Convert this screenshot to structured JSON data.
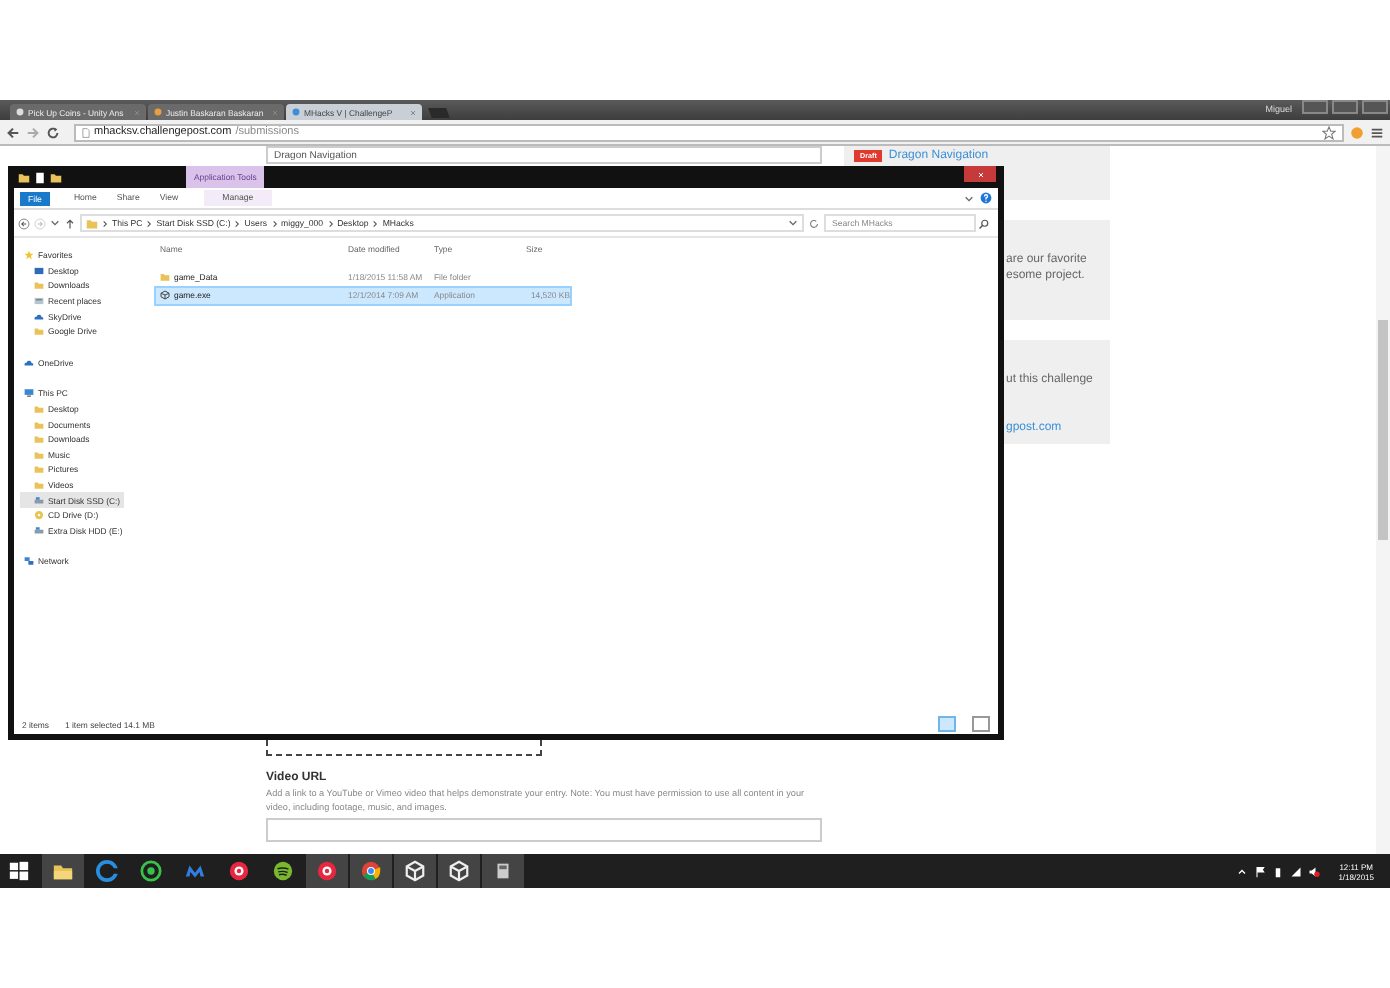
{
  "browser": {
    "tabs": [
      {
        "title": "Pick Up Coins - Unity Ans",
        "selected": false
      },
      {
        "title": "Justin Baskaran Baskaran",
        "selected": false
      },
      {
        "title": "MHacks V | ChallengeP",
        "selected": true
      }
    ],
    "user": "Miguel",
    "url_host": "mhacksv.challengepost.com",
    "url_path": "/submissions"
  },
  "page": {
    "title_field": {
      "value": "Dragon Navigation"
    },
    "cards": [
      {
        "badge": "Draft",
        "link": "Dragon Navigation"
      },
      {
        "lines": [
          "are our favorite",
          "esome project."
        ]
      },
      {
        "lines": [
          "ut this challenge"
        ],
        "link": "gpost.com"
      }
    ],
    "video_url": {
      "label": "Video URL",
      "help": "Add a link to a YouTube or Vimeo video that helps demonstrate your entry. Note: You must have permission to use all content in your video, including footage, music, and images."
    }
  },
  "explorer": {
    "contextual_tab": "Application Tools",
    "ribbon_tabs": [
      {
        "label": "File",
        "kind": "file"
      },
      {
        "label": "Home",
        "kind": "tab"
      },
      {
        "label": "Share",
        "kind": "tab"
      },
      {
        "label": "View",
        "kind": "tab"
      },
      {
        "label": "Manage",
        "kind": "tab"
      }
    ],
    "breadcrumbs": [
      "This PC",
      "Start Disk SSD (C:)",
      "Users",
      "miggy_000",
      "Desktop",
      "MHacks"
    ],
    "search": {
      "placeholder": "Search MHacks"
    },
    "nav": [
      {
        "label": "Favorites",
        "kind": "star",
        "selected": false,
        "children": [
          {
            "label": "Desktop",
            "kind": "desktop",
            "selected": false
          },
          {
            "label": "Downloads",
            "kind": "folder",
            "selected": false
          },
          {
            "label": "Recent places",
            "kind": "recent",
            "selected": false
          },
          {
            "label": "SkyDrive",
            "kind": "cloud",
            "selected": false
          },
          {
            "label": "Google Drive",
            "kind": "folder",
            "selected": false
          }
        ]
      },
      {
        "label": "OneDrive",
        "kind": "cloud",
        "selected": false
      },
      {
        "label": "This PC",
        "kind": "pc",
        "selected": false,
        "children": [
          {
            "label": "Desktop",
            "kind": "folder",
            "selected": false
          },
          {
            "label": "Documents",
            "kind": "folder",
            "selected": false
          },
          {
            "label": "Downloads",
            "kind": "folder",
            "selected": false
          },
          {
            "label": "Music",
            "kind": "folder",
            "selected": false
          },
          {
            "label": "Pictures",
            "kind": "folder",
            "selected": false
          },
          {
            "label": "Videos",
            "kind": "folder",
            "selected": false
          },
          {
            "label": "Start Disk SSD (C:)",
            "kind": "drive",
            "selected": true
          },
          {
            "label": "CD Drive (D:)",
            "kind": "disc",
            "selected": false
          },
          {
            "label": "Extra Disk HDD (E:)",
            "kind": "drive",
            "selected": false
          }
        ]
      },
      {
        "label": "Network",
        "kind": "network",
        "selected": false
      }
    ],
    "columns": [
      "Name",
      "Date modified",
      "Type",
      "Size"
    ],
    "rows": [
      {
        "name": "game_Data",
        "kind": "folder",
        "date": "1/18/2015 11:58 AM",
        "type": "File folder",
        "selected": false
      },
      {
        "name": "game.exe",
        "kind": "app",
        "date": "12/1/2014 7:09 AM",
        "type": "Application",
        "size": "14,520 KB",
        "selected": true
      }
    ],
    "status": {
      "count": "2 items",
      "selection": "1 item selected  14.1 MB"
    }
  },
  "taskbar": {
    "apps": [
      {
        "kind": "files",
        "running": true
      },
      {
        "kind": "ie",
        "running": false
      },
      {
        "kind": "green",
        "running": false
      },
      {
        "kind": "malware",
        "running": false
      },
      {
        "kind": "itunes",
        "running": false
      },
      {
        "kind": "spotify",
        "running": false
      },
      {
        "kind": "itunes",
        "running": true
      },
      {
        "kind": "chrome",
        "running": true
      },
      {
        "kind": "unity",
        "running": true
      },
      {
        "kind": "unity",
        "running": true
      },
      {
        "kind": "tool",
        "running": true
      }
    ],
    "time": "12:11 PM",
    "date": "1/18/2015"
  }
}
